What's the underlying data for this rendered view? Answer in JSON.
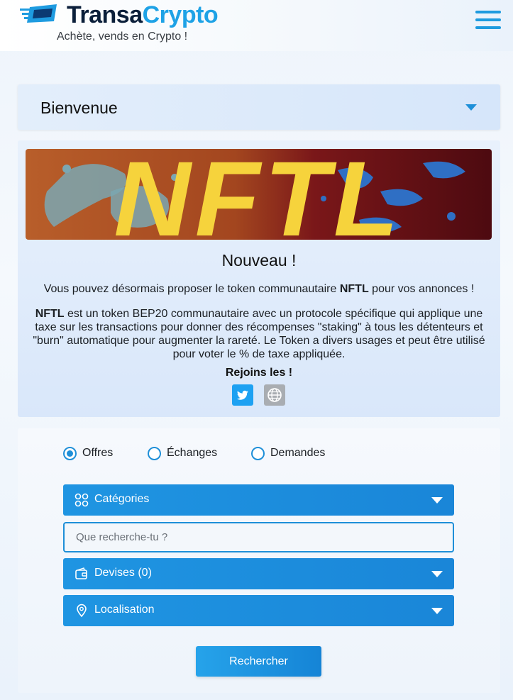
{
  "header": {
    "logo_part1": "Transa",
    "logo_part2": "Crypto",
    "tagline": "Achète, vends en Crypto !",
    "menu_icon": "hamburger-menu-icon"
  },
  "welcome": {
    "title": "Bienvenue",
    "caret_icon": "chevron-down-icon"
  },
  "news": {
    "banner_text": "NFTL",
    "title": "Nouveau !",
    "line1_prefix": "Vous pouvez désormais proposer le token communautaire ",
    "line1_token": "NFTL",
    "line1_suffix": " pour vos annonces !",
    "para_token": "NFTL",
    "para_text": " est un token BEP20 communautaire avec un protocole spécifique qui applique une taxe sur les transactions pour donner des récompenses \"staking\" à tous les détenteurs et \"burn\" automatique pour augmenter la rareté. Le Token a divers usages et peut être utilisé pour voter le % de taxe appliquée.",
    "join": "Rejoins les !",
    "social": [
      {
        "icon": "twitter-icon"
      },
      {
        "icon": "globe-icon"
      }
    ]
  },
  "search": {
    "radios": [
      {
        "label": "Offres",
        "checked": true
      },
      {
        "label": "Échanges",
        "checked": false
      },
      {
        "label": "Demandes",
        "checked": false
      }
    ],
    "categories_label": "Catégories",
    "query_placeholder": "Que recherche-tu ?",
    "currencies_label": "Devises (0)",
    "location_label": "Localisation",
    "submit_label": "Rechercher"
  },
  "colors": {
    "accent": "#1e8fd8",
    "logo_dark": "#0b1f3a",
    "logo_blue": "#1ea2e6",
    "banner_yellow": "#f6d33c",
    "banner_orange": "#b85e2a",
    "banner_maroon": "#5e0d14"
  }
}
